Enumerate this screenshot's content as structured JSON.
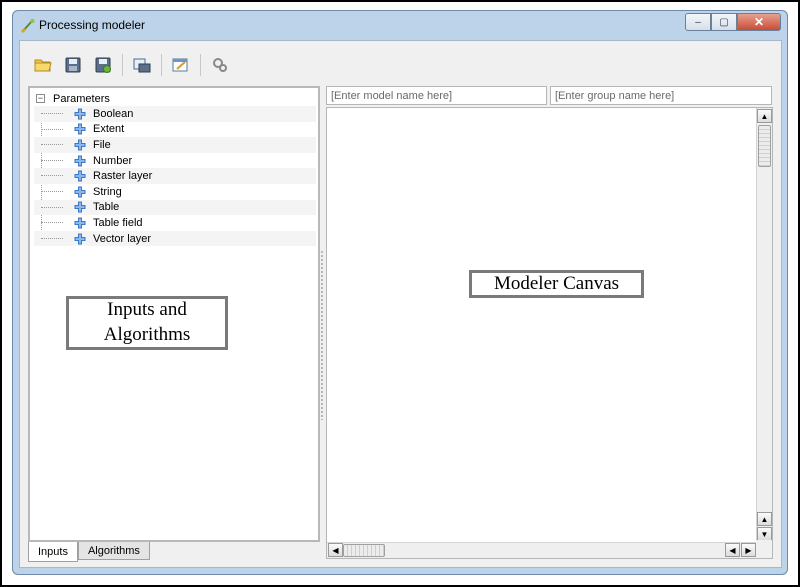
{
  "window": {
    "title": "Processing modeler",
    "controls": {
      "minimize_glyph": "–",
      "maximize_glyph": "▢",
      "close_glyph": "✕"
    }
  },
  "toolbar": {
    "buttons": [
      {
        "icon": "open-folder-icon"
      },
      {
        "icon": "save-icon"
      },
      {
        "icon": "save-as-icon"
      },
      {
        "icon": "export-image-icon"
      },
      {
        "icon": "edit-help-icon"
      },
      {
        "icon": "run-model-icon"
      }
    ]
  },
  "tree": {
    "root_label": "Parameters",
    "root_expander": "−",
    "items": [
      {
        "label": "Boolean"
      },
      {
        "label": "Extent"
      },
      {
        "label": "File"
      },
      {
        "label": "Number"
      },
      {
        "label": "Raster layer"
      },
      {
        "label": "String"
      },
      {
        "label": "Table"
      },
      {
        "label": "Table field"
      },
      {
        "label": "Vector layer"
      }
    ]
  },
  "tabs": [
    {
      "label": "Inputs",
      "active": true
    },
    {
      "label": "Algorithms",
      "active": false
    }
  ],
  "fields": {
    "model_name": {
      "value": "",
      "placeholder": "[Enter model name here]"
    },
    "group_name": {
      "value": "",
      "placeholder": "[Enter group name here]"
    }
  },
  "scrollbars": {
    "up": "▲",
    "down": "▼",
    "left": "◀",
    "right": "▶"
  },
  "callouts": {
    "left_line1": "Inputs and",
    "left_line2": "Algorithms",
    "right": "Modeler Canvas"
  },
  "colors": {
    "window_frame": "#bcd3ea",
    "client_bg": "#f0f0f0",
    "plus_icon": "#3a78c8",
    "close_button": "#c64d36"
  }
}
